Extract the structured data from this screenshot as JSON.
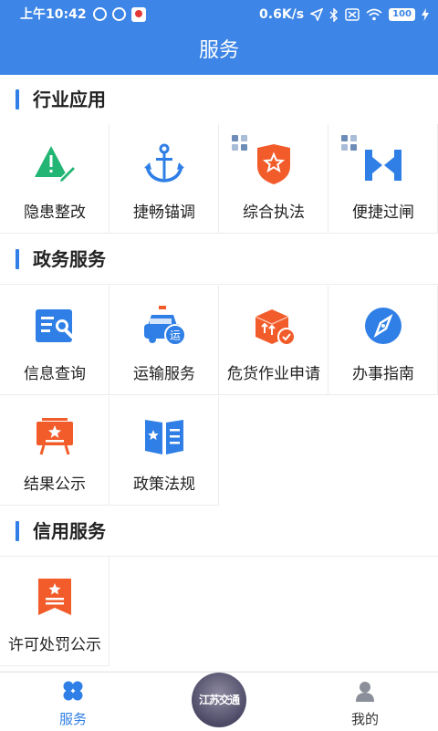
{
  "status_bar": {
    "time": "上午10:42",
    "speed": "0.6K/s",
    "battery": "100"
  },
  "header": {
    "title": "服务"
  },
  "sections": [
    {
      "title": "行业应用",
      "items": [
        {
          "label": "隐患整改",
          "icon": "warning-edit-icon"
        },
        {
          "label": "捷畅锚调",
          "icon": "anchor-icon"
        },
        {
          "label": "综合执法",
          "icon": "police-badge-icon"
        },
        {
          "label": "便捷过闸",
          "icon": "lock-gate-icon"
        }
      ]
    },
    {
      "title": "政务服务",
      "items": [
        {
          "label": "信息查询",
          "icon": "info-search-icon"
        },
        {
          "label": "运输服务",
          "icon": "transport-car-icon",
          "badge": "运"
        },
        {
          "label": "危货作业申请",
          "icon": "dangerous-goods-box-icon"
        },
        {
          "label": "办事指南",
          "icon": "compass-icon"
        },
        {
          "label": "结果公示",
          "icon": "result-board-icon"
        },
        {
          "label": "政策法规",
          "icon": "policy-book-icon"
        }
      ]
    },
    {
      "title": "信用服务",
      "items": [
        {
          "label": "许可处罚公示",
          "icon": "permit-notice-icon"
        }
      ]
    }
  ],
  "bottom_nav": {
    "tabs": [
      {
        "label": "服务",
        "icon": "grid-icon",
        "active": true
      },
      {
        "label": "我的",
        "icon": "user-icon",
        "active": false
      }
    ],
    "center_logo_text": "江苏交通"
  },
  "colors": {
    "primary": "#3d85e6",
    "accent_orange": "#f25c2a",
    "accent_green": "#22b573"
  }
}
